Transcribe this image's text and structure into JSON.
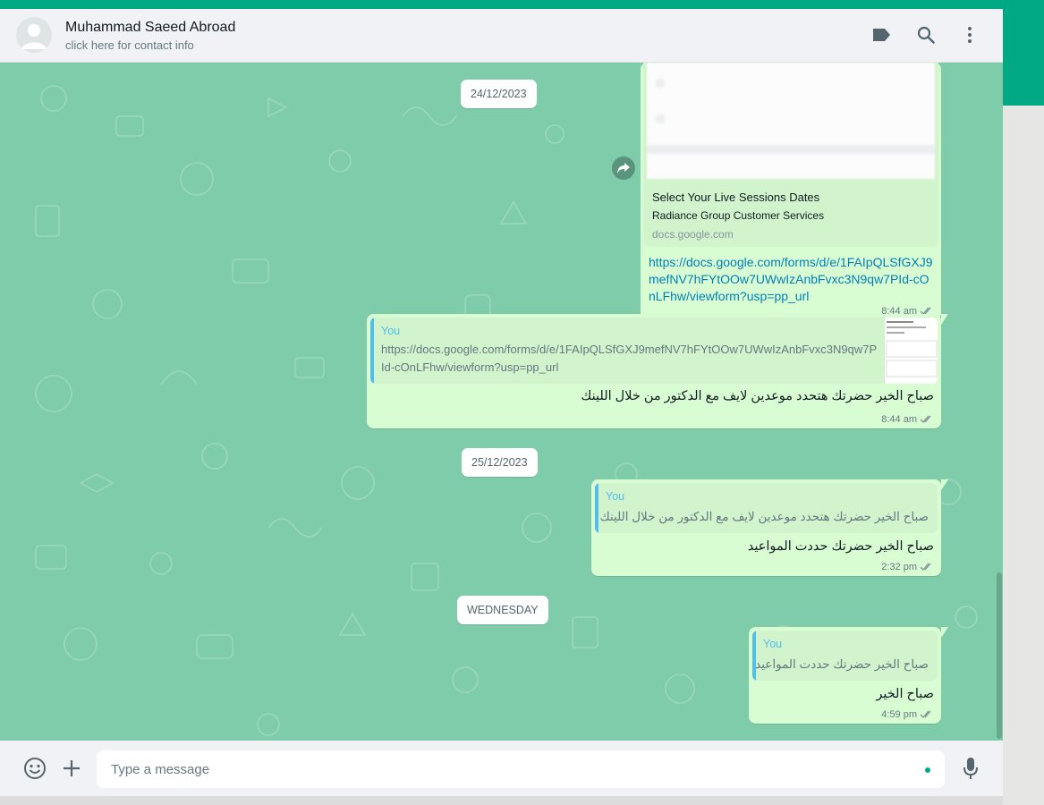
{
  "contact": {
    "name": "Muhammad Saeed Abroad",
    "subtitle": "click here for contact info"
  },
  "header_icons": [
    "label-icon",
    "search-icon",
    "menu-icon"
  ],
  "dates": {
    "d1": "24/12/2023",
    "d2": "25/12/2023",
    "d3": "WEDNESDAY"
  },
  "messages": {
    "m1": {
      "preview_title": "Select Your Live Sessions Dates",
      "preview_description": "Radiance Group Customer Services",
      "preview_domain": "docs.google.com",
      "link": "https://docs.google.com/forms/d/e/1FAIpQLSfGXJ9mefNV7hFYtOOw7UWwIzAnbFvxc3N9qw7PId-cOnLFhw/viewform?usp=pp_url",
      "time": "8:44 am"
    },
    "m2": {
      "quote_author": "You",
      "quote_text": "https://docs.google.com/forms/d/e/1FAIpQLSfGXJ9mefNV7hFYtOOw7UWwIzAnbFvxc3N9qw7PId-cOnLFhw/viewform?usp=pp_url",
      "text": "صباح الخير حضرتك هتحدد موعدين  لايف مع الدكتور من خلال اللينك",
      "time": "8:44 am"
    },
    "m3": {
      "quote_author": "You",
      "quote_text": "صباح الخير حضرتك هتحدد موعدين  لايف مع الدكتور من خلال اللينك",
      "text": "صباح الخير حضرتك حددت المواعيد",
      "time": "2:32 pm"
    },
    "m4": {
      "quote_author": "You",
      "quote_text": "صباح الخير حضرتك حددت المواعيد",
      "text": "صباح الخير",
      "time": "4:59 pm"
    }
  },
  "composer": {
    "placeholder": "Type a message"
  },
  "colors": {
    "accent": "#00a884",
    "bubble_out": "#d9fdd3",
    "quote_author": "#53bdeb",
    "link": "#027eb5",
    "read_ticks": "#8696a0"
  }
}
